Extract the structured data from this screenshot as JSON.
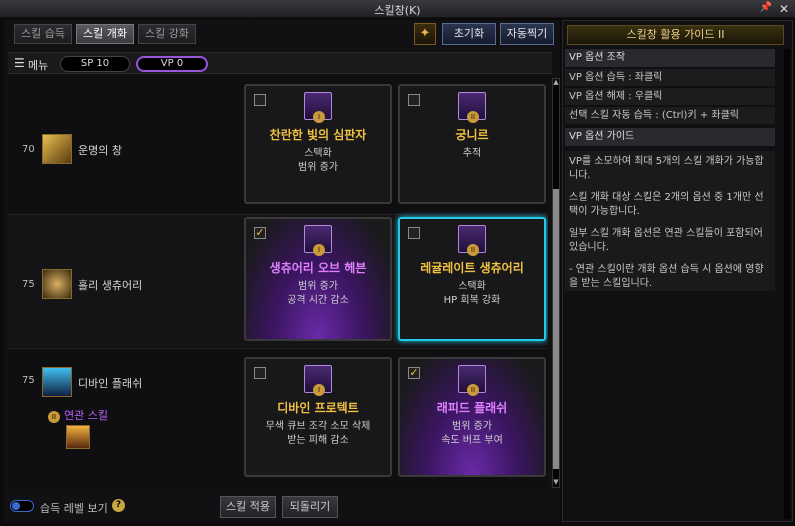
{
  "window": {
    "title": "스킬창(K)"
  },
  "tabs": [
    {
      "label": "스킬 습득",
      "active": false
    },
    {
      "label": "스킬 개화",
      "active": true
    },
    {
      "label": "스킬 강화",
      "active": false
    }
  ],
  "toolbar": {
    "reset_label": "초기화",
    "auto_label": "자동찍기"
  },
  "menubar": {
    "menu_label": "메뉴",
    "sp_label": "SP 10",
    "vp_label": "VP 0"
  },
  "skills": [
    {
      "level": "70",
      "name": "운명의 창",
      "options": [
        {
          "title": "찬란한 빛의 심판자",
          "lines": [
            "스택화",
            "범위 증가"
          ],
          "roman": "I",
          "checked": false,
          "style": "plain"
        },
        {
          "title": "궁니르",
          "lines": [
            "추적"
          ],
          "roman": "II",
          "checked": false,
          "style": "plain"
        }
      ]
    },
    {
      "level": "75",
      "name": "홀리 생츄어리",
      "options": [
        {
          "title": "생츄어리 오브 헤븐",
          "lines": [
            "범위 증가",
            "공격 시간 감소"
          ],
          "roman": "I",
          "checked": true,
          "style": "purple"
        },
        {
          "title": "레귤레이트 생츄어리",
          "lines": [
            "스택화",
            "HP 회복 강화"
          ],
          "roman": "II",
          "checked": false,
          "style": "selected"
        }
      ]
    },
    {
      "level": "75",
      "name": "디바인 플래쉬",
      "related_label": "연관 스킬",
      "options": [
        {
          "title": "디바인 프로텍트",
          "lines": [
            "무색 큐브 조각 소모 삭제",
            "받는 피해 감소"
          ],
          "roman": "I",
          "checked": false,
          "style": "plain"
        },
        {
          "title": "래피드 플래쉬",
          "lines": [
            "범위 증가",
            "속도 버프 부여"
          ],
          "roman": "II",
          "checked": true,
          "style": "purple"
        }
      ]
    }
  ],
  "bottom": {
    "toggle_label": "습득 레벨 보기",
    "apply_label": "스킬 적용",
    "revert_label": "되돌리기"
  },
  "guide": {
    "title": "스킬창 활용 가이드 II",
    "section1": "VP 옵션 조작",
    "items": [
      "VP 옵션 습득 : 좌클릭",
      "VP 옵션 해제 : 우클릭",
      "선택 스킬 자동 습득 : (Ctrl)키 + 좌클릭"
    ],
    "section2": "VP 옵션 가이드",
    "paragraphs": [
      "VP를 소모하여 최대 5개의 스킬 개화가 가능합니다.",
      "스킬 개화 대상 스킬은 2개의 옵션 중 1개만 선택이 가능합니다.",
      "일부 스킬 개화 옵션은 연관 스킬들이 포함되어 있습니다.",
      "- 연관 스킬이란 개화 옵션 습득 시 옵션에 영향을 받는 스킬입니다."
    ]
  },
  "colors": {
    "accent_gold": "#f0c040",
    "accent_purple": "#9a55e0",
    "selected_cyan": "#23c9e6"
  }
}
